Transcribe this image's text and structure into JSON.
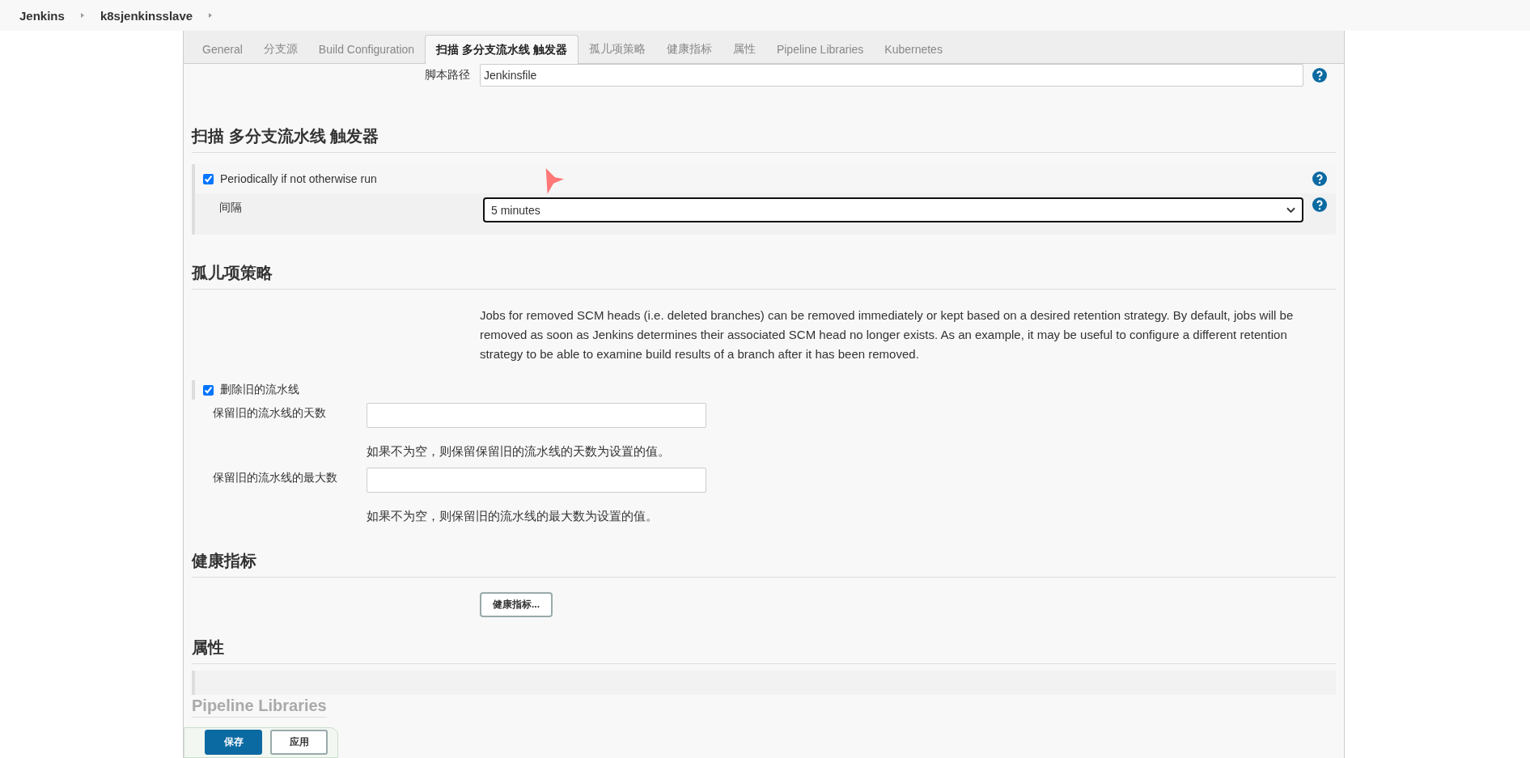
{
  "breadcrumbs": [
    {
      "label": "Jenkins"
    },
    {
      "label": "k8sjenkinsslave"
    }
  ],
  "tabs": [
    {
      "label": "General",
      "selected": false
    },
    {
      "label": "分支源",
      "selected": false
    },
    {
      "label": "Build Configuration",
      "selected": false
    },
    {
      "label": "扫描 多分支流水线 触发器",
      "selected": true
    },
    {
      "label": "孤儿项策略",
      "selected": false
    },
    {
      "label": "健康指标",
      "selected": false
    },
    {
      "label": "属性",
      "selected": false
    },
    {
      "label": "Pipeline Libraries",
      "selected": false
    },
    {
      "label": "Kubernetes",
      "selected": false
    }
  ],
  "script_path": {
    "label": "脚本路径",
    "value": "Jenkinsfile"
  },
  "trigger_section": {
    "title": "扫描 多分支流水线 触发器",
    "option": {
      "label": "Periodically if not otherwise run",
      "checked": true
    },
    "interval": {
      "label": "间隔",
      "value": "5 minutes"
    }
  },
  "orphan_section": {
    "title": "孤儿项策略",
    "description": "Jobs for removed SCM heads (i.e. deleted branches) can be removed immediately or kept based on a desired retention strategy. By default, jobs will be removed as soon as Jenkins determines their associated SCM head no longer exists. As an example, it may be useful to configure a different retention strategy to be able to examine build results of a branch after it has been removed.",
    "option": {
      "label": "删除旧的流水线",
      "checked": true
    },
    "fields": [
      {
        "label": "保留旧的流水线的天数",
        "hint": "如果不为空，则保留保留旧的流水线的天数为设置的值。"
      },
      {
        "label": "保留旧的流水线的最大数",
        "hint": "如果不为空，则保留旧的流水线的最大数为设置的值。"
      }
    ]
  },
  "health_section": {
    "title": "健康指标",
    "button": "健康指标..."
  },
  "properties_section": {
    "title": "属性"
  },
  "libraries_section": {
    "title": "Pipeline Libraries"
  },
  "footer_buttons": [
    {
      "label": "保存",
      "kind": "primary"
    },
    {
      "label": "应用",
      "kind": "secondary"
    }
  ]
}
